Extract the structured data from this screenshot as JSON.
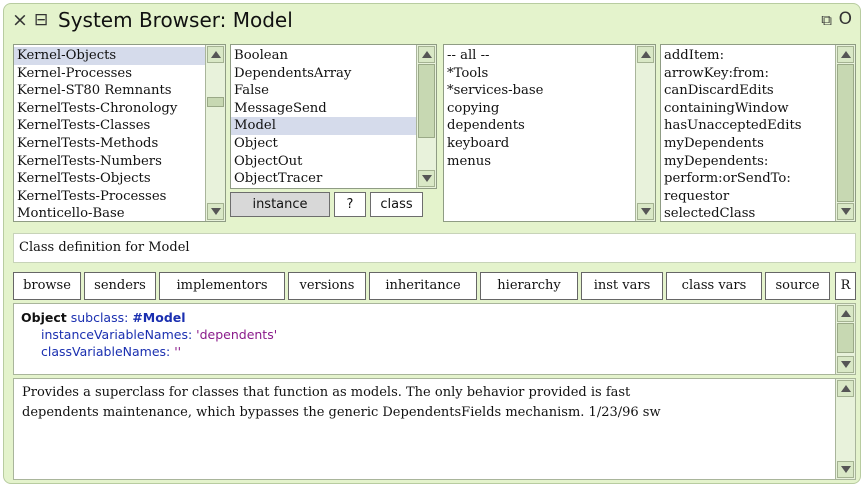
{
  "window": {
    "title": "System Browser: Model",
    "close_glyph": "×",
    "menu_glyph": "⊟",
    "collapse_glyph": "⧉",
    "expand_glyph": "O"
  },
  "packages": {
    "items": [
      "Kernel-Objects",
      "Kernel-Processes",
      "Kernel-ST80 Remnants",
      "KernelTests-Chronology",
      "KernelTests-Classes",
      "KernelTests-Methods",
      "KernelTests-Numbers",
      "KernelTests-Objects",
      "KernelTests-Processes",
      "Monticello-Base"
    ],
    "selected": 0
  },
  "classes": {
    "items": [
      "Boolean",
      "DependentsArray",
      "False",
      "MessageSend",
      "Model",
      "Object",
      "ObjectOut",
      "ObjectTracer"
    ],
    "selected": 4
  },
  "categories": {
    "items": [
      "-- all --",
      "*Tools",
      "*services-base",
      "copying",
      "dependents",
      "keyboard",
      "menus"
    ]
  },
  "methods": {
    "items": [
      "addItem:",
      "arrowKey:from:",
      "canDiscardEdits",
      "containingWindow",
      "hasUnacceptedEdits",
      "myDependents",
      "myDependents:",
      "perform:orSendTo:",
      "requestor",
      "selectedClass"
    ]
  },
  "toggles": {
    "instance": "instance",
    "help": "?",
    "class": "class",
    "active": "instance"
  },
  "label_row": "Class definition for Model",
  "buttons": {
    "browse": "browse",
    "senders": "senders",
    "implementors": "implementors",
    "versions": "versions",
    "inheritance": "inheritance",
    "hierarchy": "hierarchy",
    "inst_vars": "inst vars",
    "class_vars": "class vars",
    "source": "source",
    "r": "R"
  },
  "code": {
    "superclass": "Object",
    "keyword_subclass": "subclass:",
    "symbol": "#Model",
    "keyword_ivars": "instanceVariableNames:",
    "ivars_value": "'dependents'",
    "keyword_cvars": "classVariableNames:",
    "cvars_value": "''"
  },
  "comment": {
    "line1": "Provides a superclass for classes that function as models.  The only behavior provided is fast",
    "line2": "dependents maintenance, which bypasses the generic DependentsFields mechanism.  1/23/96 sw"
  },
  "colors": {
    "window_bg": "#e4f3cc",
    "selection": "#d5dbeb",
    "keyword_blue": "#1a2fb0",
    "string_purple": "#8a1a8a"
  }
}
